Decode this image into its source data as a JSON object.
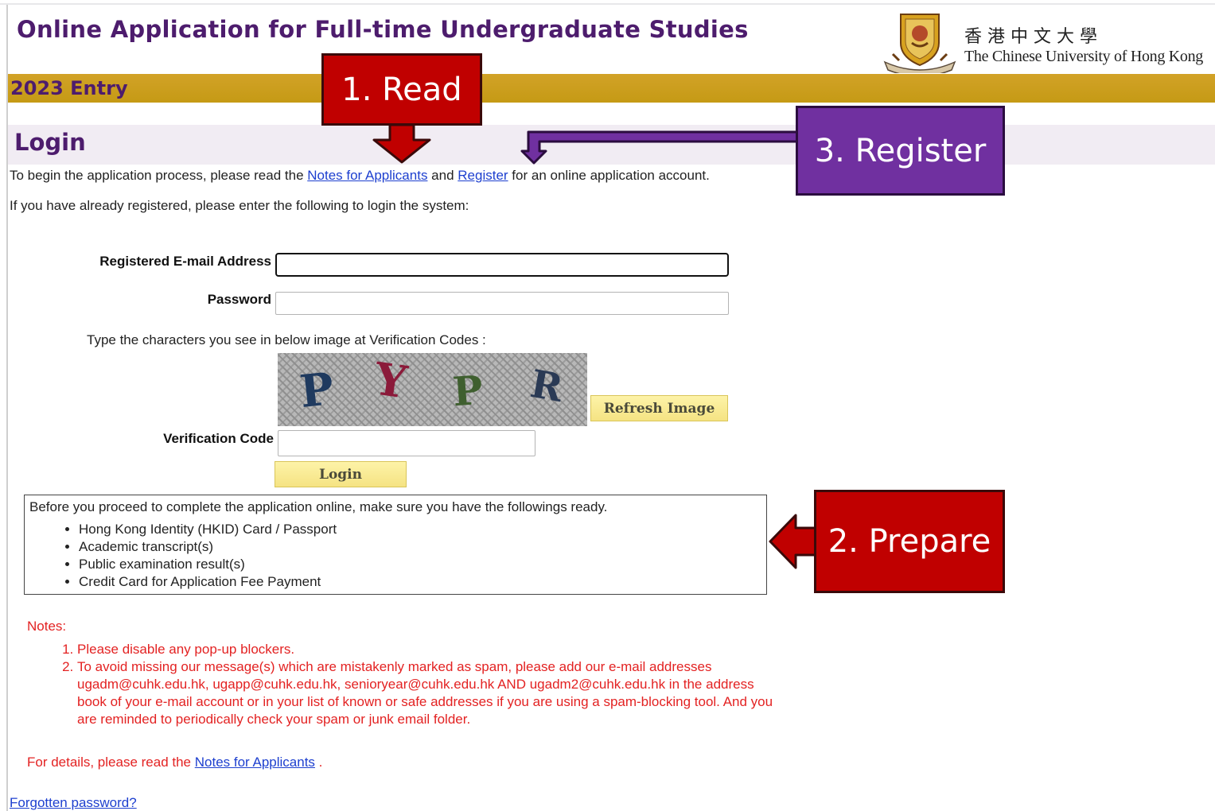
{
  "header": {
    "title": "Online Application for Full-time Undergraduate Studies",
    "university_cn": "香港中文大學",
    "university_en": "The Chinese University of Hong Kong",
    "entry": "2023 Entry"
  },
  "login": {
    "heading": "Login",
    "intro_before": "To begin the application process, please read the ",
    "notes_link": "Notes for Applicants",
    "intro_and": " and ",
    "register_link": "Register",
    "intro_after": " for an online application account.",
    "already_registered": "If you have already registered, please enter the following to login the system:",
    "email_label": "Registered E-mail Address",
    "email_value": "",
    "password_label": "Password",
    "password_value": "",
    "captcha_instruction": "Type the characters you see in below image at Verification Codes :",
    "captcha_chars": [
      "P",
      "Y",
      "P",
      "R"
    ],
    "captcha_colors": [
      "#1f3a5f",
      "#8b1a3a",
      "#3f5f2f",
      "#2a3a55"
    ],
    "refresh_button": "Refresh Image",
    "verification_label": "Verification Code",
    "verification_value": "",
    "login_button": "Login"
  },
  "prepare": {
    "intro": "Before you proceed to complete the application online, make sure you have the followings ready.",
    "items": [
      "Hong Kong Identity (HKID) Card / Passport",
      "Academic transcript(s)",
      "Public examination result(s)",
      "Credit Card for Application Fee Payment"
    ]
  },
  "notes": {
    "title": "Notes:",
    "items": [
      "Please disable any pop-up blockers.",
      "To avoid missing our message(s) which are mistakenly marked as spam, please add our e-mail addresses ugadm@cuhk.edu.hk, ugapp@cuhk.edu.hk, senioryear@cuhk.edu.hk AND ugadm2@cuhk.edu.hk in the address book of your e-mail account or in your list of known or safe addresses if you are using a spam-blocking tool. And you are reminded to periodically check your spam or junk email folder."
    ],
    "details_before": "For details, please read the ",
    "details_link": "Notes for Applicants",
    "details_after": " ."
  },
  "forgot_link": "Forgotten password?",
  "callouts": {
    "read": "1. Read",
    "prepare": "2. Prepare",
    "register": "3. Register"
  },
  "colors": {
    "brand_purple": "#4d1c6d",
    "gold_bar": "#c99d1c",
    "link_blue": "#1d3fcf",
    "notes_red": "#e32222",
    "callout_red": "#c00000",
    "callout_purple": "#7030a0"
  }
}
